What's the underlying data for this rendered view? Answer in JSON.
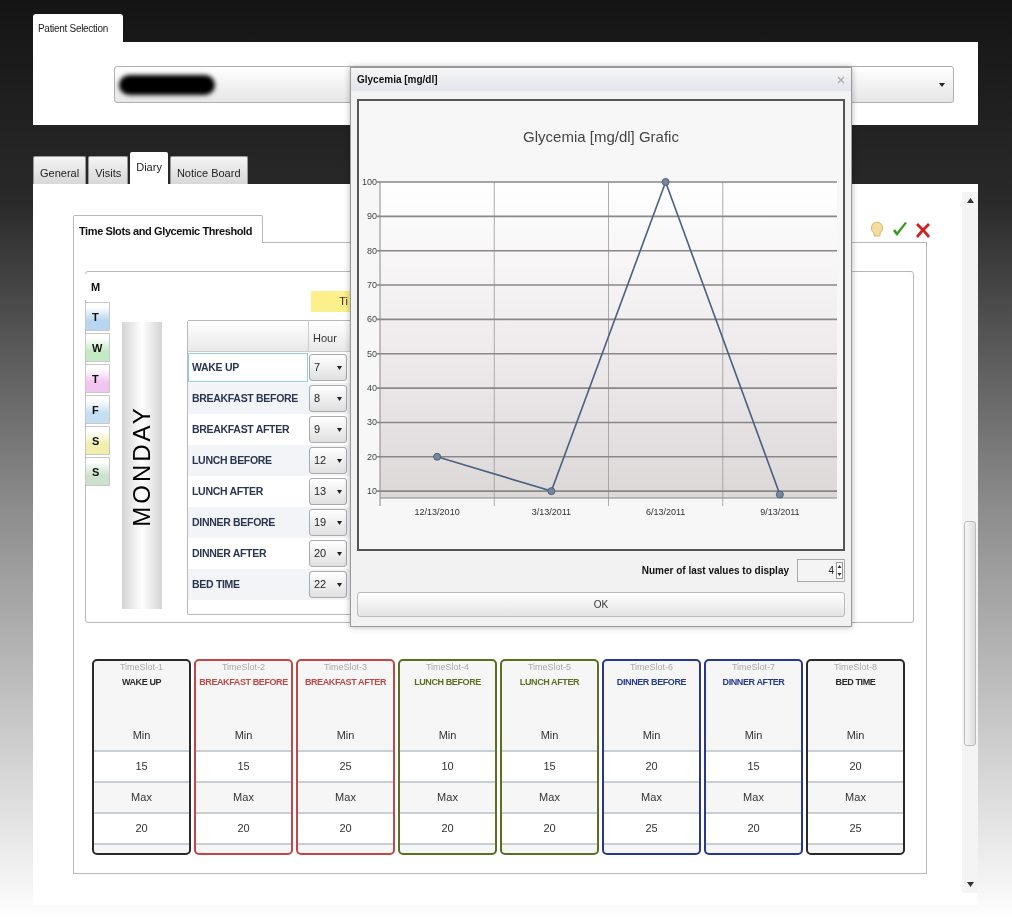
{
  "patient_selection": {
    "tab": "Patient Selection"
  },
  "tabs": [
    {
      "label": "General",
      "selected": false
    },
    {
      "label": "Visits",
      "selected": false
    },
    {
      "label": "Diary",
      "selected": true
    },
    {
      "label": "Notice Board",
      "selected": false
    }
  ],
  "groupbox": {
    "title": "Time Slots and Glycemic Threshold"
  },
  "days": [
    {
      "label": "M",
      "selected": true,
      "color": "#ffffff"
    },
    {
      "label": "T",
      "selected": false,
      "color": "#b8d6f2"
    },
    {
      "label": "W",
      "selected": false,
      "color": "#c4eac4"
    },
    {
      "label": "T",
      "selected": false,
      "color": "#f2c4f0"
    },
    {
      "label": "F",
      "selected": false,
      "color": "#c4def4"
    },
    {
      "label": "S",
      "selected": false,
      "color": "#f2eeae"
    },
    {
      "label": "S",
      "selected": false,
      "color": "#cce2cc"
    }
  ],
  "day_title": "MONDAY",
  "yellow_label": "Ti",
  "hours_table": {
    "columns": [
      "Hour"
    ],
    "rows": [
      {
        "slot": "WAKE UP",
        "hour": "7",
        "focused": true
      },
      {
        "slot": "BREAKFAST BEFORE",
        "hour": "8",
        "focused": false
      },
      {
        "slot": "BREAKFAST AFTER",
        "hour": "9",
        "focused": false
      },
      {
        "slot": "LUNCH BEFORE",
        "hour": "12",
        "focused": false
      },
      {
        "slot": "LUNCH AFTER",
        "hour": "13",
        "focused": false
      },
      {
        "slot": "DINNER BEFORE",
        "hour": "19",
        "focused": false
      },
      {
        "slot": "DINNER AFTER",
        "hour": "20",
        "focused": false
      },
      {
        "slot": "BED TIME",
        "hour": "22",
        "focused": false
      }
    ]
  },
  "timeslots": [
    {
      "slot": "TimeSlot-1",
      "name": "WAKE UP",
      "color": "#2a2a2a",
      "min_label": "Min",
      "min": "15",
      "max_label": "Max",
      "max": "20"
    },
    {
      "slot": "TimeSlot-2",
      "name": "BREAKFAST BEFORE",
      "color": "#c04848",
      "min_label": "Min",
      "min": "15",
      "max_label": "Max",
      "max": "20"
    },
    {
      "slot": "TimeSlot-3",
      "name": "BREAKFAST AFTER",
      "color": "#c04848",
      "min_label": "Min",
      "min": "25",
      "max_label": "Max",
      "max": "20"
    },
    {
      "slot": "TimeSlot-4",
      "name": "LUNCH BEFORE",
      "color": "#5a7020",
      "min_label": "Min",
      "min": "10",
      "max_label": "Max",
      "max": "20"
    },
    {
      "slot": "TimeSlot-5",
      "name": "LUNCH AFTER",
      "color": "#5a7020",
      "min_label": "Min",
      "min": "15",
      "max_label": "Max",
      "max": "20"
    },
    {
      "slot": "TimeSlot-6",
      "name": "DINNER BEFORE",
      "color": "#283890",
      "min_label": "Min",
      "min": "20",
      "max_label": "Max",
      "max": "25"
    },
    {
      "slot": "TimeSlot-7",
      "name": "DINNER AFTER",
      "color": "#283890",
      "min_label": "Min",
      "min": "15",
      "max_label": "Max",
      "max": "20"
    },
    {
      "slot": "TimeSlot-8",
      "name": "BED TIME",
      "color": "#2a2a2a",
      "min_label": "Min",
      "min": "20",
      "max_label": "Max",
      "max": "25"
    }
  ],
  "dialog": {
    "title": "Glycemia [mg/dl]",
    "chart_data": {
      "type": "line",
      "title": "Glycemia [mg/dl] Grafic",
      "categories": [
        "12/13/2010",
        "3/13/2011",
        "6/13/2011",
        "9/13/2011"
      ],
      "values": [
        20,
        10,
        100,
        9
      ],
      "ylim": [
        8,
        100
      ],
      "grid": true,
      "marker": true,
      "yticks": [
        10,
        20,
        30,
        40,
        50,
        60,
        70,
        80,
        90,
        100
      ]
    },
    "count_label": "Numer of last values to display",
    "count_value": "4",
    "ok": "OK"
  }
}
